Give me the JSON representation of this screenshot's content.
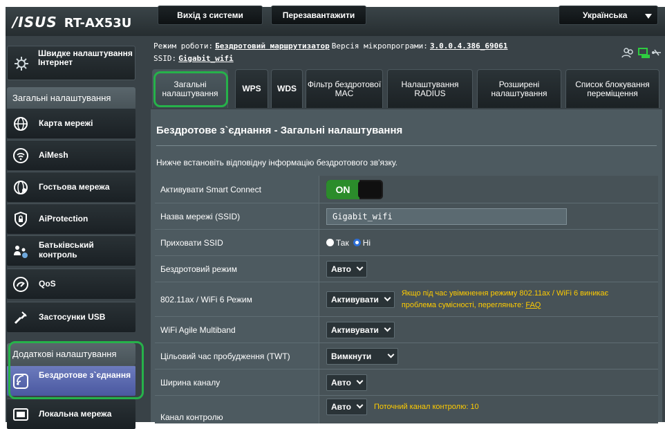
{
  "header": {
    "brand": "/ISUS",
    "model": "RT-AX53U",
    "logout_label": "Вихід з системи",
    "reboot_label": "Перезавантажити",
    "language": "Українська"
  },
  "mode_line": {
    "mode_label": "Режим роботи:",
    "mode_value": "Бездротовий маршрутизатор",
    "fw_label": "Версія мікропрограми:",
    "fw_value": "3.0.0.4.386_69061",
    "ssid_label": "SSID:",
    "ssid_value": "Gigabit_wifi"
  },
  "sidebar": {
    "quick_label": "Швидке налаштування Інтернет",
    "general_header": "Загальні налаштування",
    "items": [
      {
        "label": "Карта мережі"
      },
      {
        "label": "AiMesh"
      },
      {
        "label": "Гостьова мережа"
      },
      {
        "label": "AiProtection"
      },
      {
        "label": "Батьківський контроль"
      },
      {
        "label": "QoS"
      },
      {
        "label": "Застосунки USB"
      }
    ],
    "advanced_header": "Додаткові налаштування",
    "advanced_items": [
      {
        "label": "Бездротове з`єднання"
      },
      {
        "label": "Локальна мережа"
      }
    ]
  },
  "tabs": [
    {
      "label": "Загальні налаштування"
    },
    {
      "label": "WPS"
    },
    {
      "label": "WDS"
    },
    {
      "label": "Фільтр бездротової MAC"
    },
    {
      "label": "Налаштування RADIUS"
    },
    {
      "label": "Розширені налаштування"
    },
    {
      "label": "Список блокування переміщення"
    }
  ],
  "panel": {
    "title": "Бездротове з`єднання - Загальні налаштування",
    "description": "Нижче встановіть відповідну інформацію бездротового зв'язку.",
    "rows": {
      "smart_connect": {
        "label": "Активувати Smart Connect",
        "value": "ON"
      },
      "ssid": {
        "label": "Назва мережі (SSID)",
        "value": "Gigabit_wifi"
      },
      "hide_ssid": {
        "label": "Приховати SSID",
        "yes": "Так",
        "no": "Ні"
      },
      "wireless_mode": {
        "label": "Бездротовий режим",
        "value": "Авто"
      },
      "ax_mode": {
        "label": "802.11ax / WiFi 6 Режим",
        "value": "Активувати",
        "note": "Якщо під час увімкнення режиму 802.11ax / WiFi 6 виникає проблема сумісності, перегляньте:",
        "note_link": "FAQ"
      },
      "agile": {
        "label": "WiFi Agile Multiband",
        "value": "Активувати"
      },
      "twt": {
        "label": "Цільовий час пробудження (TWT)",
        "value": "Вимкнути"
      },
      "bandwidth": {
        "label": "Ширина каналу",
        "value": "Авто"
      },
      "control_channel": {
        "label": "Канал контролю",
        "value": "Авто",
        "note": "Поточний канал контролю: 10"
      }
    }
  }
}
